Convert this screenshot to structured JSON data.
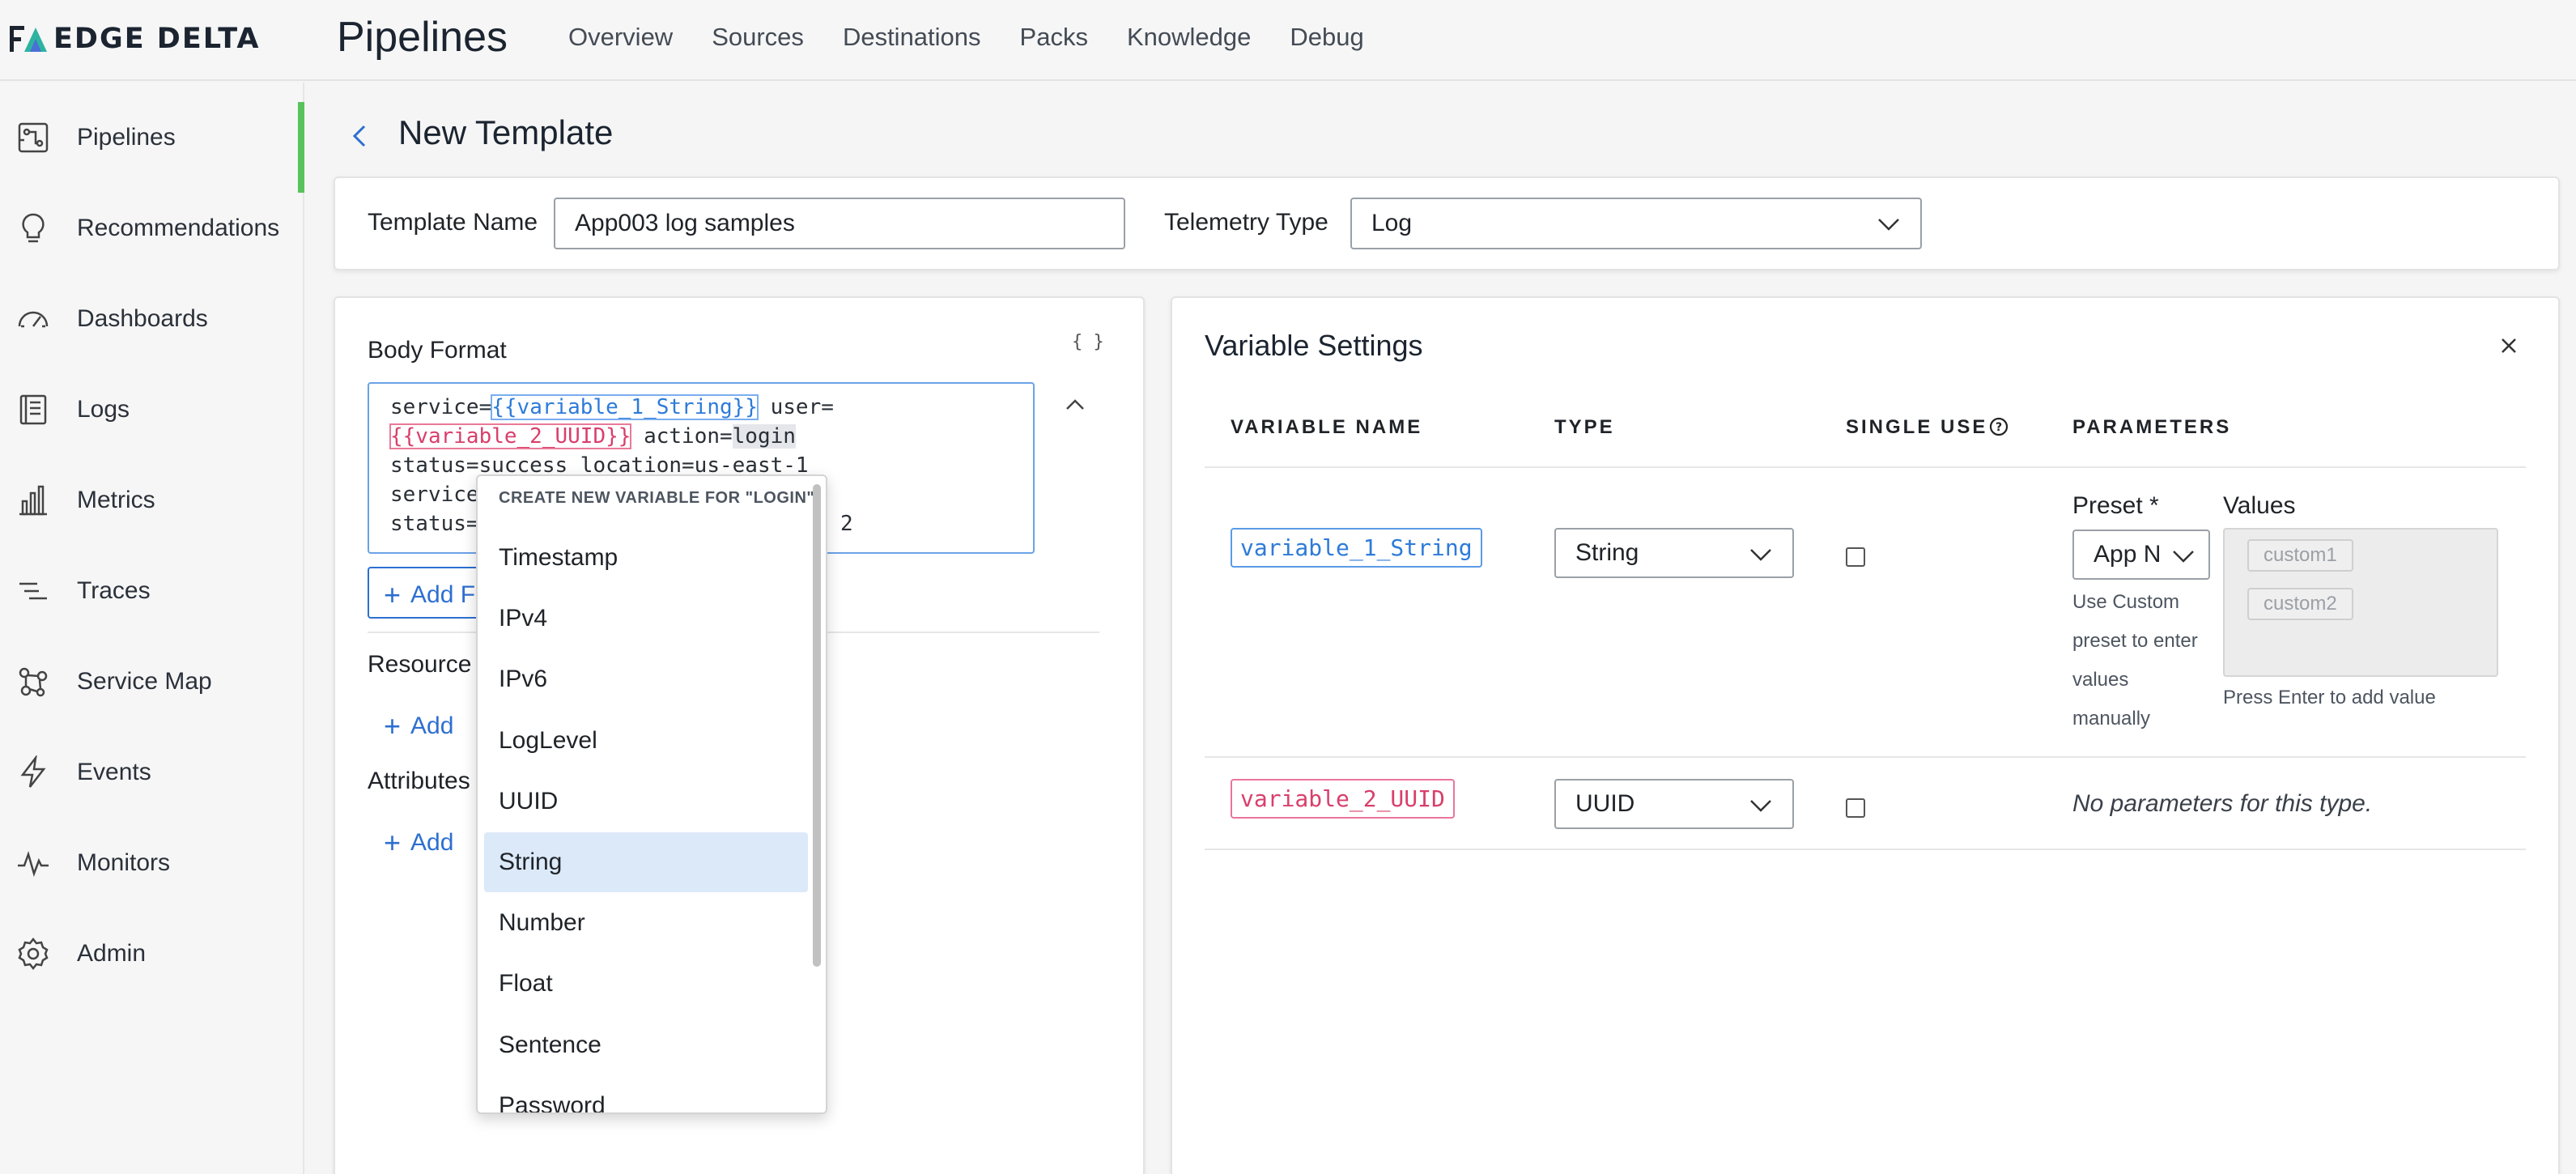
{
  "app": {
    "logo_text": "EDGE DELTA",
    "page_heading": "Pipelines",
    "top_nav": [
      "Overview",
      "Sources",
      "Destinations",
      "Packs",
      "Knowledge",
      "Debug"
    ]
  },
  "sidebar": {
    "items": [
      {
        "label": "Pipelines",
        "icon": "pipelines-icon",
        "active": true
      },
      {
        "label": "Recommendations",
        "icon": "lightbulb-icon"
      },
      {
        "label": "Dashboards",
        "icon": "gauge-icon"
      },
      {
        "label": "Logs",
        "icon": "logs-icon"
      },
      {
        "label": "Metrics",
        "icon": "bar-chart-icon"
      },
      {
        "label": "Traces",
        "icon": "traces-icon"
      },
      {
        "label": "Service Map",
        "icon": "service-map-icon"
      },
      {
        "label": "Events",
        "icon": "bolt-icon"
      },
      {
        "label": "Monitors",
        "icon": "pulse-icon"
      },
      {
        "label": "Admin",
        "icon": "gear-icon"
      }
    ]
  },
  "template": {
    "title": "New Template",
    "name_label": "Template Name",
    "name_value": "App003 log samples",
    "telemetry_label": "Telemetry Type",
    "telemetry_value": "Log"
  },
  "body_format": {
    "label": "Body Format",
    "braces_icon": "{ }",
    "line1_a": "service=",
    "line1_var": "{{variable_1_String}}",
    "line1_b": " user=",
    "line2_var": "{{variable_2_UUID}}",
    "line2_b": " action=",
    "line2_sel": "login",
    "line3": "status=success location=us-east-1",
    "line4": "service",
    "line5_a": "status=",
    "line5_b": "2",
    "add_field_label": "Add F",
    "resource_label": "Resource",
    "resource_add": "Add",
    "attributes_label": "Attributes",
    "attributes_add": "Add"
  },
  "dropdown": {
    "header": "CREATE NEW VARIABLE FOR \"LOGIN\"",
    "items": [
      "Timestamp",
      "IPv4",
      "IPv6",
      "LogLevel",
      "UUID",
      "String",
      "Number",
      "Float",
      "Sentence",
      "Password"
    ],
    "highlighted": "String"
  },
  "variable_settings": {
    "title": "Variable Settings",
    "columns": [
      "VARIABLE NAME",
      "TYPE",
      "SINGLE USE",
      "PARAMETERS"
    ],
    "rows": [
      {
        "name": "variable_1_String",
        "type": "String",
        "single_use": false,
        "preset_label": "Preset *",
        "preset_value": "App N",
        "preset_hint": [
          "Use Custom",
          "preset to enter",
          "values",
          "manually"
        ],
        "values_label": "Values",
        "values": [
          "custom1",
          "custom2"
        ],
        "values_hint": "Press Enter to add value"
      },
      {
        "name": "variable_2_UUID",
        "type": "UUID",
        "single_use": false,
        "note": "No parameters for this type."
      }
    ]
  },
  "colors": {
    "accent_green": "#57c35b",
    "link_blue": "#2d6fd0",
    "var_blue": "#2d7bd9",
    "var_red": "#d93f6b",
    "highlight": "#dce9f9"
  }
}
